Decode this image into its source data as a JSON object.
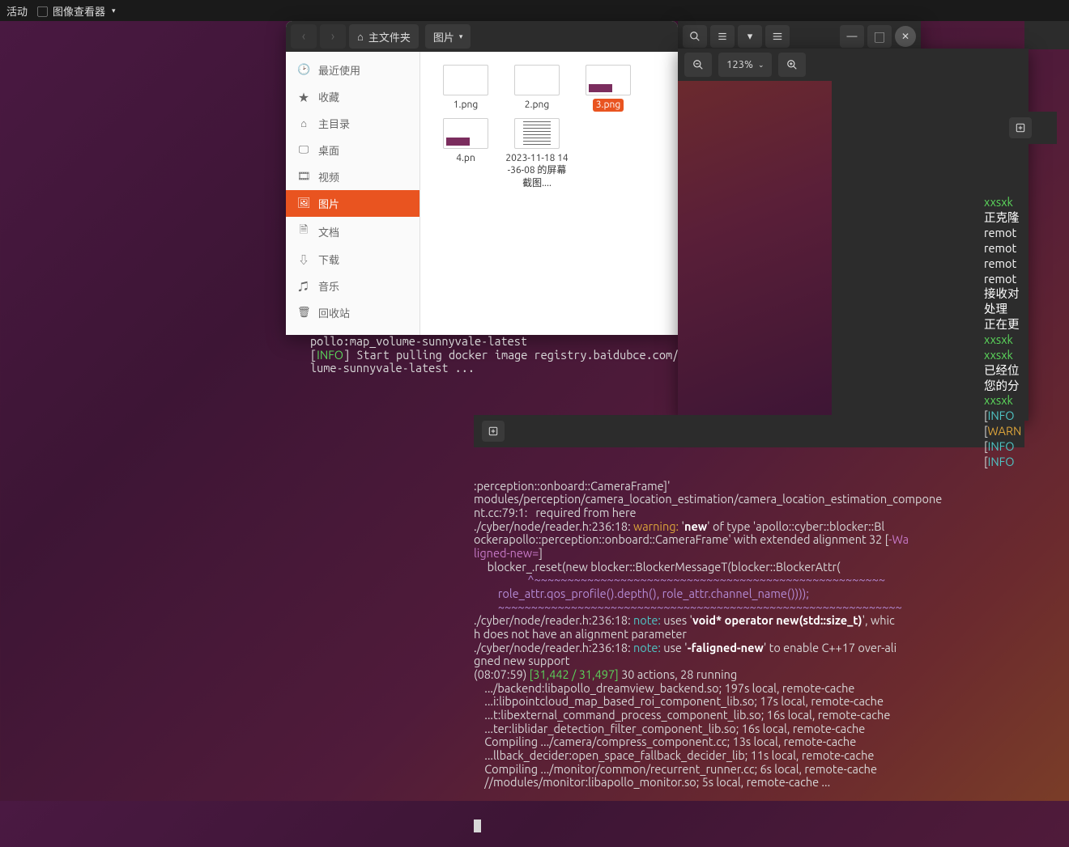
{
  "topbar": {
    "activities": "活动",
    "app_name": "图像查看器"
  },
  "file_manager": {
    "path_home": "主文件夹",
    "path_current": "图片",
    "sidebar": [
      {
        "icon": "🕑",
        "label": "最近使用",
        "name": "recent"
      },
      {
        "icon": "★",
        "label": "收藏",
        "name": "starred"
      },
      {
        "icon": "⌂",
        "label": "主目录",
        "name": "home"
      },
      {
        "icon": "🖵",
        "label": "桌面",
        "name": "desktop"
      },
      {
        "icon": "🎞",
        "label": "视频",
        "name": "videos"
      },
      {
        "icon": "🖼",
        "label": "图片",
        "name": "pictures",
        "active": true
      },
      {
        "icon": "🗎",
        "label": "文档",
        "name": "documents"
      },
      {
        "icon": "⇩",
        "label": "下载",
        "name": "downloads"
      },
      {
        "icon": "♫",
        "label": "音乐",
        "name": "music"
      },
      {
        "icon": "🗑",
        "label": "回收站",
        "name": "trash"
      }
    ],
    "files": [
      {
        "name": "1.png",
        "thumb": "plain"
      },
      {
        "name": "2.png",
        "thumb": "plain"
      },
      {
        "name": "3.png",
        "thumb": "bar",
        "selected": true
      },
      {
        "name": "4.pn",
        "thumb": "bar"
      },
      {
        "name": "2023-11-18 14-36-08 的屏幕截图....",
        "thumb": "doc"
      }
    ]
  },
  "image_viewer": {
    "zoom": "123%"
  },
  "terminal1": {
    "lines": [
      "pollo:map_volume-sunnyvale-latest",
      "[<INFO>] Start pulling docker image registry.baidubce.com/",
      "lume-sunnyvale-latest ..."
    ]
  },
  "terminal2": {
    "raw": ":perception::onboard::CameraFrame]'\nmodules/perception/camera_location_estimation/camera_location_estimation_compone\nnt.cc:79:1:   required from here\n./cyber/node/reader.h:236:18: <warning:> '<new>' of type '<apollo::cyber::blocker::Bl\nocker<apollo::perception::onboard::CameraFrame>>' with extended alignment 32 [<-Wa\nligned-new=>]\n     blocker_.reset(<new blocker::Blocker<MessageT>(blocker::BlockerAttr(>\n                    <^~~~~~~~~~~~~~~~~~~~~~~~~~~~~~~~~~~~~~~~~~~~~~~~~~~~~~>\n         <role_attr.qos_profile().depth(), role_attr.channel_name())));>\n         <~~~~~~~~~~~~~~~~~~~~~~~~~~~~~~~~~~~~~~~~~~~~~~~~~~~~~~~~~~~~~>\n./cyber/node/reader.h:236:18: <note:> uses '<void* operator new(std::size_t)>', whic\nh does not have an alignment parameter\n./cyber/node/reader.h:236:18: <note:> use '<-faligned-new>' to enable C++17 over-ali\ngned new support\n(08:07:59) <[31,442 / 31,497]> 30 actions, 28 running\n    .../backend:libapollo_dreamview_backend.so; 197s local, remote-cache\n    ...i:libpointcloud_map_based_roi_component_lib.so; 17s local, remote-cache\n    ...t:libexternal_command_process_component_lib.so; 16s local, remote-cache\n    ...ter:liblidar_detection_filter_component_lib.so; 16s local, remote-cache\n    Compiling .../camera/compress_component.cc; 13s local, remote-cache\n    ...llback_decider:open_space_fallback_decider_lib; 11s local, remote-cache\n    Compiling .../monitor/common/recurrent_runner.cc; 6s local, remote-cache\n    //modules/monitor:libapollo_monitor.so; 5s local, remote-cache ..."
  },
  "terminal3": {
    "lines": [
      {
        "cls": "c-green2",
        "text": "xxsxk"
      },
      {
        "cls": "c-white",
        "text": "正克隆"
      },
      {
        "cls": "c-white",
        "text": "remot"
      },
      {
        "cls": "c-white",
        "text": "remot"
      },
      {
        "cls": "c-white",
        "text": "remot"
      },
      {
        "cls": "c-white",
        "text": "remot"
      },
      {
        "cls": "c-white",
        "text": "接收对"
      },
      {
        "cls": "c-white",
        "text": "处理 "
      },
      {
        "cls": "c-white",
        "text": "正在更"
      },
      {
        "cls": "c-green2",
        "text": "xxsxk"
      },
      {
        "cls": "c-green2",
        "text": "xxsxk"
      },
      {
        "cls": "c-white",
        "text": "已经位"
      },
      {
        "cls": "c-white",
        "text": "您的分"
      },
      {
        "cls": "c-green2",
        "text": "xxsxk"
      },
      {
        "cls": "",
        "text": "[INFO"
      },
      {
        "cls": "",
        "text": "[WARN"
      },
      {
        "cls": "",
        "text": "[INFO"
      },
      {
        "cls": "",
        "text": "[INFO"
      }
    ]
  }
}
